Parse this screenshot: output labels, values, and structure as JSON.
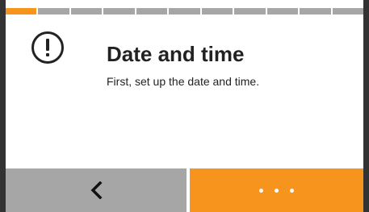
{
  "progress": {
    "total_steps": 11,
    "current_step": 1
  },
  "dialog": {
    "icon": "exclamation-circle-icon",
    "title": "Date and time",
    "message": "First, set up the date and time."
  },
  "buttons": {
    "back": {
      "icon": "chevron-left-icon"
    },
    "more": {
      "icon": "ellipsis-icon"
    }
  },
  "colors": {
    "accent": "#f7941d",
    "inactive": "#a6a6a6",
    "frame": "#333333",
    "text": "#222222"
  }
}
